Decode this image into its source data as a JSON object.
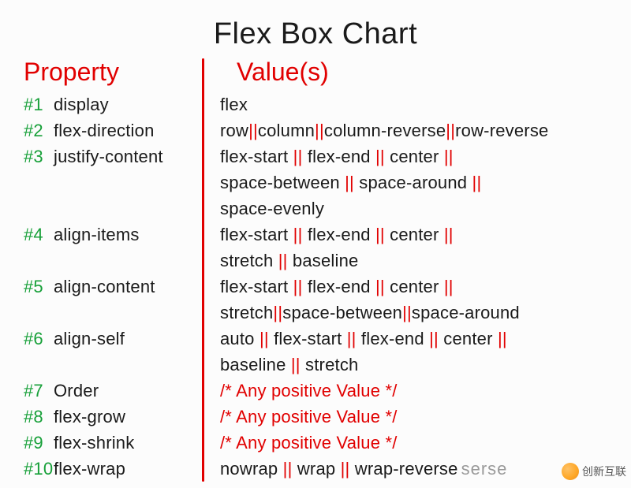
{
  "title": "Flex Box Chart",
  "header_property": "Property",
  "header_value": "Value(s)",
  "separator_glyph": "||",
  "rows": [
    {
      "num": "#1",
      "prop": "display",
      "kind": "values",
      "values": [
        "flex"
      ]
    },
    {
      "num": "#2",
      "prop": "flex-direction",
      "kind": "values",
      "values": [
        "row",
        "column",
        "column-reverse",
        "row-reverse"
      ],
      "tight": true
    },
    {
      "num": "#3",
      "prop": "justify-content",
      "kind": "values",
      "values": [
        "flex-start",
        "flex-end",
        "center",
        "space-between",
        "space-around",
        "space-evenly"
      ],
      "trailing_sep_after": [
        2,
        4
      ]
    },
    {
      "num": "#4",
      "prop": "align-items",
      "kind": "values",
      "values": [
        "flex-start",
        "flex-end",
        "center",
        "stretch",
        "baseline"
      ],
      "trailing_sep_after": [
        2
      ]
    },
    {
      "num": "#5",
      "prop": "align-content",
      "kind": "values",
      "values": [
        "flex-start",
        "flex-end",
        "center",
        "stretch",
        "space-between",
        "space-around"
      ],
      "trailing_sep_after": [
        2
      ],
      "tight_after": 2
    },
    {
      "num": "#6",
      "prop": "align-self",
      "kind": "values",
      "values": [
        "auto",
        "flex-start",
        "flex-end",
        "center",
        "baseline",
        "stretch"
      ],
      "trailing_sep_after": [
        3
      ]
    },
    {
      "num": "#7",
      "prop": "Order",
      "kind": "comment",
      "comment": "/* Any positive Value */"
    },
    {
      "num": "#8",
      "prop": "flex-grow",
      "kind": "comment",
      "comment": "/* Any positive Value */"
    },
    {
      "num": "#9",
      "prop": "flex-shrink",
      "kind": "comment",
      "comment": "/* Any positive Value */"
    },
    {
      "num": "#10",
      "prop": "flex-wrap",
      "kind": "values",
      "values": [
        "nowrap",
        "wrap",
        "wrap-reverse"
      ],
      "extra_suffix": "serse"
    }
  ],
  "watermark": "创新互联"
}
